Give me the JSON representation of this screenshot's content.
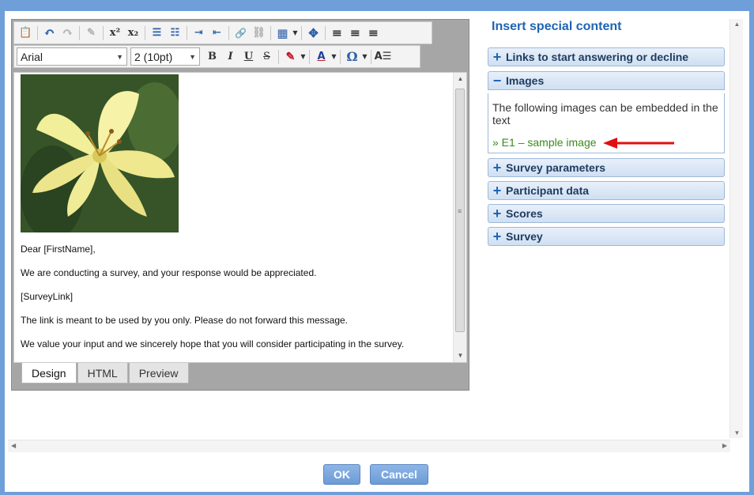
{
  "editor": {
    "toolbar_row1": [
      {
        "name": "paste-word-icon",
        "glyph": "📋",
        "disabled": false
      },
      {
        "name": "undo-icon",
        "glyph": "↶",
        "disabled": false
      },
      {
        "name": "redo-icon",
        "glyph": "↷",
        "disabled": true
      },
      {
        "name": "format-stripper-icon",
        "glyph": "✎",
        "disabled": true
      },
      {
        "name": "superscript-icon",
        "glyph": "x²",
        "disabled": false
      },
      {
        "name": "subscript-icon",
        "glyph": "x₂",
        "disabled": false
      },
      {
        "name": "numbered-list-icon",
        "glyph": "☰",
        "disabled": false
      },
      {
        "name": "bullet-list-icon",
        "glyph": "☷",
        "disabled": false
      },
      {
        "name": "indent-icon",
        "glyph": "⇥",
        "disabled": false
      },
      {
        "name": "outdent-icon",
        "glyph": "⇤",
        "disabled": false
      },
      {
        "name": "insert-link-icon",
        "glyph": "🔗",
        "disabled": false
      },
      {
        "name": "remove-link-icon",
        "glyph": "⛓",
        "disabled": true
      },
      {
        "name": "insert-table-icon",
        "glyph": "▦",
        "disabled": false
      },
      {
        "name": "move-icon",
        "glyph": "✥",
        "disabled": false
      },
      {
        "name": "align-left-icon",
        "glyph": "≡",
        "disabled": false
      },
      {
        "name": "align-center-icon",
        "glyph": "≡",
        "disabled": false
      },
      {
        "name": "align-right-icon",
        "glyph": "≡",
        "disabled": false
      }
    ],
    "font_family": "Arial",
    "font_size": "2 (10pt)",
    "bold": "B",
    "italic": "I",
    "underline": "U",
    "strike": "S",
    "special_char": "Ω",
    "font_color_letter": "A",
    "body_lines": [
      "Dear [FirstName],",
      "We are conducting a survey, and your response would be appreciated.",
      "[SurveyLink]",
      "The link is meant to be used by you only. Please do not forward this message.",
      "We value your input and we sincerely hope that you will consider participating in the survey."
    ],
    "tabs": [
      "Design",
      "HTML",
      "Preview"
    ],
    "active_tab": "Design"
  },
  "side_panel": {
    "title": "Insert special content",
    "sections": [
      {
        "label": "Links to start answering or decline",
        "expanded": false
      },
      {
        "label": "Images",
        "expanded": true
      },
      {
        "label": "Survey parameters",
        "expanded": false
      },
      {
        "label": "Participant data",
        "expanded": false
      },
      {
        "label": "Scores",
        "expanded": false
      },
      {
        "label": "Survey",
        "expanded": false
      }
    ],
    "images_description": "The following images can be embedded in the text",
    "image_link": "» E1 – sample image",
    "arrow_color": "#e01010"
  },
  "buttons": {
    "ok": "OK",
    "cancel": "Cancel"
  },
  "colors": {
    "accent": "#1e64b4",
    "link_green": "#3a8a1c",
    "frame": "#6f9fd8"
  }
}
